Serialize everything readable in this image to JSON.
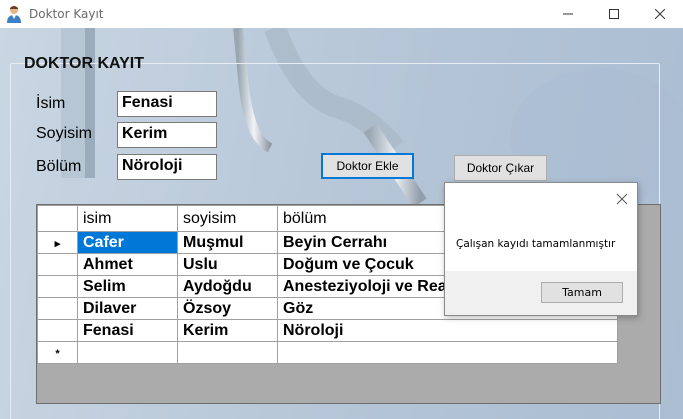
{
  "window": {
    "title": "Doktor Kayıt",
    "icon": "doctor-person-icon"
  },
  "form": {
    "group_title": "DOKTOR KAYIT",
    "labels": {
      "isim": "İsim",
      "soyisim": "Soyisim",
      "bolum": "Bölüm"
    },
    "values": {
      "isim": "Fenasi",
      "soyisim": "Kerim",
      "bolum": "Nöroloji"
    },
    "buttons": {
      "add": "Doktor Ekle",
      "remove": "Doktor Çıkar"
    }
  },
  "grid": {
    "columns": [
      "isim",
      "soyisim",
      "bölüm"
    ],
    "rows": [
      [
        "Cafer",
        "Muşmul",
        "Beyin Cerrahı"
      ],
      [
        "Ahmet",
        "Uslu",
        "Doğum ve Çocuk"
      ],
      [
        "Selim",
        "Aydoğdu",
        "Anesteziyoloji ve Reanimasyon"
      ],
      [
        "Dilaver",
        "Özsoy",
        "Göz"
      ],
      [
        "Fenasi",
        "Kerim",
        "Nöroloji"
      ]
    ],
    "new_row_marker": "*",
    "current_row_marker": "▸"
  },
  "dialog": {
    "message": "Çalışan kayıdı tamamlanmıştır",
    "ok_label": "Tamam"
  },
  "colors": {
    "selection": "#0078d7",
    "grid_background": "#ababab",
    "accent_border": "#0078d7"
  }
}
